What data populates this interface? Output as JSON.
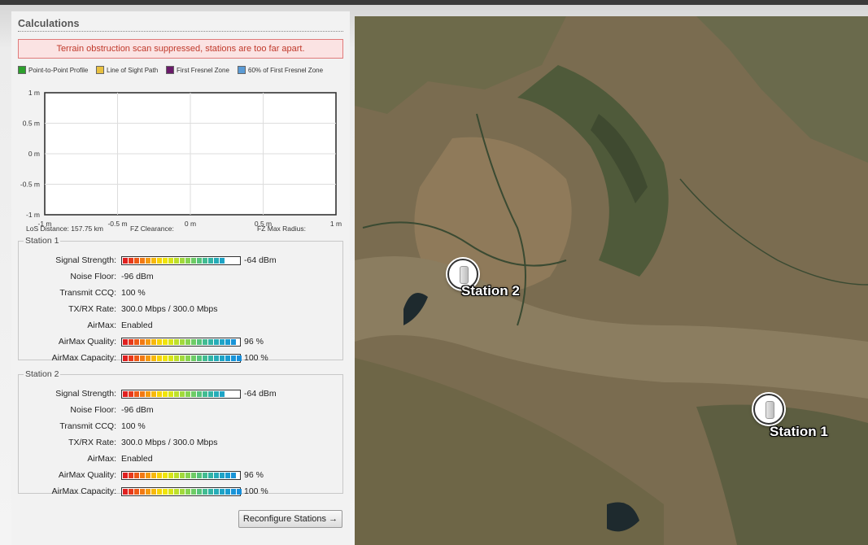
{
  "calculations": {
    "title": "Calculations",
    "alert": "Terrain obstruction scan suppressed, stations are too far apart."
  },
  "legend": [
    {
      "label": "Point-to-Point Profile",
      "color": "#2ca02c"
    },
    {
      "label": "Line of Sight Path",
      "color": "#e8c040"
    },
    {
      "label": "First Fresnel Zone",
      "color": "#6a1b6a"
    },
    {
      "label": "60% of First Fresnel Zone",
      "color": "#5b9bd5"
    }
  ],
  "chart_data": {
    "type": "line",
    "series": [],
    "xlim": [
      -1,
      1
    ],
    "ylim": [
      -1,
      1
    ],
    "x_ticks": [
      "-1 m",
      "-0.5 m",
      "0 m",
      "0.5 m",
      "1 m"
    ],
    "y_ticks": [
      "1 m",
      "0.5 m",
      "0 m",
      "-0.5 m",
      "-1 m"
    ],
    "grid": true
  },
  "los": {
    "distance": "LoS Distance: 157.75 km",
    "fz_clearance": "FZ Clearance:",
    "fz_max_radius": "FZ Max Radius:"
  },
  "stations": [
    {
      "title": "Station 1",
      "signal_strength_label": "Signal Strength:",
      "signal_strength": "-64 dBm",
      "signal_strength_fraction": 0.88,
      "noise_floor_label": "Noise Floor:",
      "noise_floor": "-96 dBm",
      "transmit_ccq_label": "Transmit CCQ:",
      "transmit_ccq": "100 %",
      "txrx_rate_label": "TX/RX Rate:",
      "txrx_rate": "300.0 Mbps / 300.0 Mbps",
      "airmax_label": "AirMax:",
      "airmax": "Enabled",
      "airmax_quality_label": "AirMax Quality:",
      "airmax_quality": "96 %",
      "airmax_quality_fraction": 0.96,
      "airmax_capacity_label": "AirMax Capacity:",
      "airmax_capacity": "100 %",
      "airmax_capacity_fraction": 1.0
    },
    {
      "title": "Station 2",
      "signal_strength_label": "Signal Strength:",
      "signal_strength": "-64 dBm",
      "signal_strength_fraction": 0.88,
      "noise_floor_label": "Noise Floor:",
      "noise_floor": "-96 dBm",
      "transmit_ccq_label": "Transmit CCQ:",
      "transmit_ccq": "100 %",
      "txrx_rate_label": "TX/RX Rate:",
      "txrx_rate": "300.0 Mbps / 300.0 Mbps",
      "airmax_label": "AirMax:",
      "airmax": "Enabled",
      "airmax_quality_label": "AirMax Quality:",
      "airmax_quality": "96 %",
      "airmax_quality_fraction": 0.96,
      "airmax_capacity_label": "AirMax Capacity:",
      "airmax_capacity": "100 %",
      "airmax_capacity_fraction": 1.0
    }
  ],
  "reconfigure_button": "Reconfigure Stations →",
  "map": {
    "station2_label": "Station 2",
    "station1_label": "Station 1",
    "marker_icon": "access-point-icon"
  },
  "meter_colors": [
    "#e02020",
    "#e83a1c",
    "#ee5a18",
    "#f27a14",
    "#f59a10",
    "#f7b80c",
    "#f8d408",
    "#f0e40a",
    "#d8e418",
    "#bde02a",
    "#a2da3c",
    "#88d450",
    "#6ecc66",
    "#56c47c",
    "#42bc92",
    "#32b4a6",
    "#26acb8",
    "#1ea4c6",
    "#1a9cd0",
    "#1894d8",
    "#1890dc"
  ]
}
